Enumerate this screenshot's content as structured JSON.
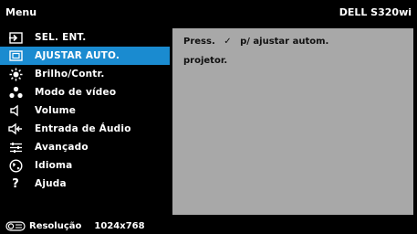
{
  "header": {
    "title": "Menu",
    "model": "DELL S320wi"
  },
  "sidebar": {
    "items": [
      {
        "label": "SEL. ENT.",
        "icon": "input-icon"
      },
      {
        "label": "AJUSTAR AUTO.",
        "icon": "auto-adjust-icon",
        "active": true
      },
      {
        "label": "Brilho/Contr.",
        "icon": "brightness-icon"
      },
      {
        "label": "Modo de vídeo",
        "icon": "video-mode-icon"
      },
      {
        "label": "Volume",
        "icon": "speaker-icon"
      },
      {
        "label": "Entrada de Áudio",
        "icon": "audio-input-icon"
      },
      {
        "label": "Avançado",
        "icon": "advanced-icon"
      },
      {
        "label": "Idioma",
        "icon": "language-icon"
      },
      {
        "label": "Ajuda",
        "icon": "help-icon"
      }
    ]
  },
  "panel": {
    "line1_prefix": "Press.",
    "line1_check": "✓",
    "line1_suffix": "p/ ajustar autom.",
    "line2": "projetor."
  },
  "footer": {
    "resolution_label": "Resolução",
    "resolution_value": "1024x768"
  },
  "colors": {
    "accent": "#1a8bd0",
    "panel": "#a8a8a8",
    "background": "#000000"
  }
}
